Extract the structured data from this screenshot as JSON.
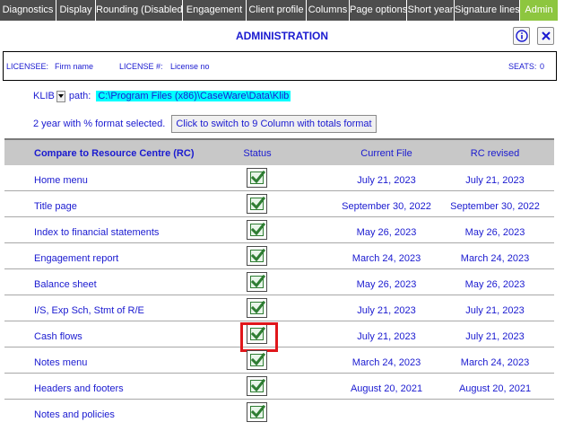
{
  "tabs": [
    {
      "label": "Diagnostics",
      "active": false
    },
    {
      "label": "Display",
      "active": false
    },
    {
      "label": "Rounding (Disabled)",
      "active": false
    },
    {
      "label": "Engagement",
      "active": false
    },
    {
      "label": "Client profile",
      "active": false
    },
    {
      "label": "Columns",
      "active": false
    },
    {
      "label": "Page options",
      "active": false
    },
    {
      "label": "Short year",
      "active": false
    },
    {
      "label": "Signature lines",
      "active": false
    },
    {
      "label": "Admin",
      "active": true
    }
  ],
  "header": {
    "title": "ADMINISTRATION",
    "info_icon": "info-icon",
    "close_icon": "close-icon"
  },
  "license": {
    "licensee_label": "LICENSEE:",
    "licensee_value": "Firm name",
    "license_label": "LICENSE #:",
    "license_value": "License no",
    "seats_label": "SEATS:",
    "seats_value": "0"
  },
  "klib": {
    "selector_label": "KLIB",
    "path_label": "path:",
    "path_value": "C:\\Program Files (x86)\\CaseWare\\Data\\Klib"
  },
  "format": {
    "status_text": "2 year with % format selected.",
    "switch_button": "Click to switch to 9 Column with totals format"
  },
  "table": {
    "headers": {
      "name": "Compare to Resource Centre (RC)",
      "status": "Status",
      "current": "Current File",
      "rc": "RC revised"
    },
    "rows": [
      {
        "name": "Home menu",
        "current": "July 21, 2023",
        "rc": "July 21, 2023",
        "checked": true
      },
      {
        "name": "Title page",
        "current": "September 30, 2022",
        "rc": "September 30, 2022",
        "checked": true
      },
      {
        "name": "Index to financial statements",
        "current": "May 26, 2023",
        "rc": "May 26, 2023",
        "checked": true
      },
      {
        "name": "Engagement report",
        "current": "March 24, 2023",
        "rc": "March 24, 2023",
        "checked": true
      },
      {
        "name": "Balance sheet",
        "current": "May 26, 2023",
        "rc": "May 26, 2023",
        "checked": true
      },
      {
        "name": "I/S, Exp Sch, Stmt of R/E",
        "current": "July 21, 2023",
        "rc": "July 21, 2023",
        "checked": true
      },
      {
        "name": "Cash flows",
        "current": "July 21, 2023",
        "rc": "July 21, 2023",
        "checked": true,
        "highlighted": true
      },
      {
        "name": "Notes menu",
        "current": "March 24, 2023",
        "rc": "March 24, 2023",
        "checked": true
      },
      {
        "name": "Headers and footers",
        "current": "August 20, 2021",
        "rc": "August 20, 2021",
        "checked": true
      },
      {
        "name": "Notes and policies",
        "current": "",
        "rc": "",
        "checked": true
      }
    ]
  },
  "colors": {
    "accent_tab": "#8dc63f",
    "tab_bg": "#4d4d4d",
    "text_blue": "#1a1ad0",
    "path_highlight": "#00ffff",
    "highlight_box": "#e0161b",
    "check_green": "#2e7d32"
  }
}
